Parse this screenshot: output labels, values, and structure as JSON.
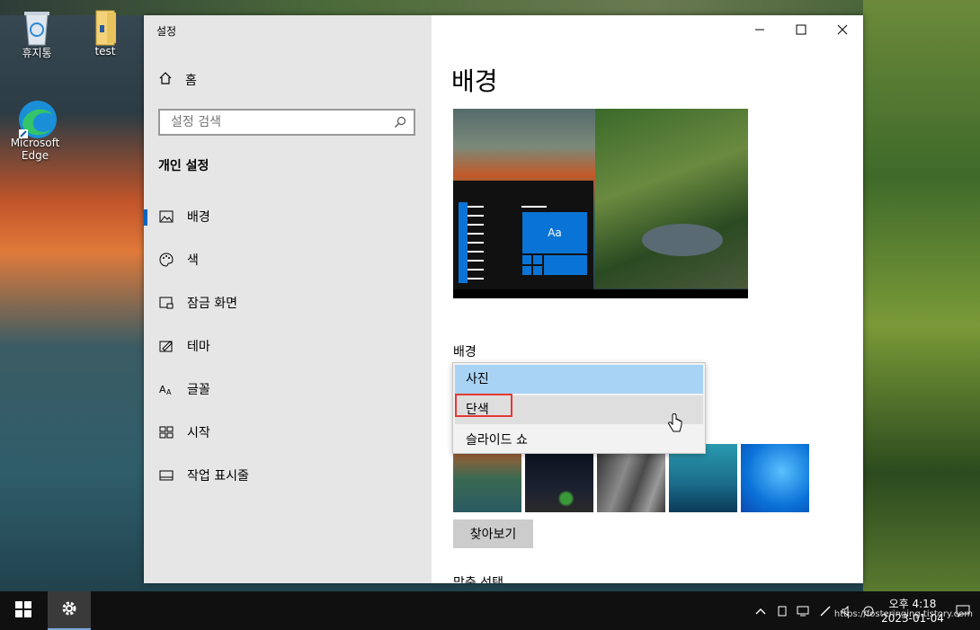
{
  "desktop": {
    "icons": [
      {
        "label": "휴지통"
      },
      {
        "label": "test"
      },
      {
        "label": "Microsoft Edge"
      }
    ]
  },
  "window": {
    "title": "설정",
    "minimize": "—",
    "maximize": "☐",
    "close": "✕"
  },
  "sidebar": {
    "home_label": "홈",
    "search_placeholder": "설정 검색",
    "section": "개인 설정",
    "items": [
      {
        "label": "배경",
        "icon": "image-icon",
        "active": true
      },
      {
        "label": "색",
        "icon": "palette-icon"
      },
      {
        "label": "잠금 화면",
        "icon": "lock-screen-icon"
      },
      {
        "label": "테마",
        "icon": "theme-icon"
      },
      {
        "label": "글꼴",
        "icon": "font-icon"
      },
      {
        "label": "시작",
        "icon": "start-icon"
      },
      {
        "label": "작업 표시줄",
        "icon": "taskbar-icon"
      }
    ]
  },
  "main": {
    "title": "배경",
    "preview_tile_text": "Aa",
    "background_label": "배경",
    "dropdown_options": [
      "사진",
      "단색",
      "슬라이드 쇼"
    ],
    "selected_option": "사진",
    "browse_button": "찾아보기",
    "fit_label": "맞춤 선택"
  },
  "taskbar": {
    "time": "오후 4:18",
    "date": "2023-01-04",
    "watermark": "https://fosteringing.tistory.com"
  },
  "colors": {
    "accent": "#0067c0",
    "dropdown_selected": "#a8d3f5",
    "highlight": "#e53935"
  }
}
